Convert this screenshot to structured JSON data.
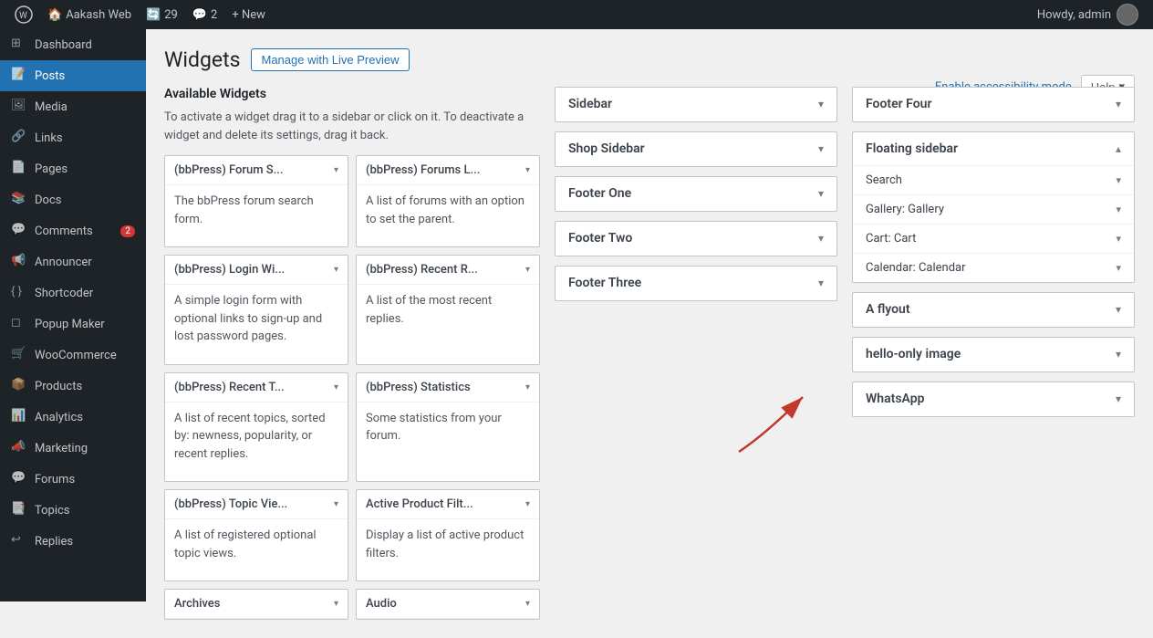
{
  "adminbar": {
    "wp_logo": "⊞",
    "site_name": "Aakash Web",
    "updates_count": "29",
    "comments_count": "2",
    "new_label": "+ New",
    "howdy": "Howdy, admin"
  },
  "sidebar": {
    "items": [
      {
        "id": "dashboard",
        "label": "Dashboard",
        "icon": "⊞"
      },
      {
        "id": "posts",
        "label": "Posts",
        "icon": "📝",
        "active": true
      },
      {
        "id": "media",
        "label": "Media",
        "icon": "🖼"
      },
      {
        "id": "links",
        "label": "Links",
        "icon": "🔗"
      },
      {
        "id": "pages",
        "label": "Pages",
        "icon": "📄"
      },
      {
        "id": "docs",
        "label": "Docs",
        "icon": "📚"
      },
      {
        "id": "comments",
        "label": "Comments",
        "icon": "💬",
        "badge": "2"
      },
      {
        "id": "announcer",
        "label": "Announcer",
        "icon": "📢"
      },
      {
        "id": "shortcoder",
        "label": "Shortcoder",
        "icon": "{ }"
      },
      {
        "id": "popup-maker",
        "label": "Popup Maker",
        "icon": "◻"
      },
      {
        "id": "woocommerce",
        "label": "WooCommerce",
        "icon": "🛒"
      },
      {
        "id": "products",
        "label": "Products",
        "icon": "📦"
      },
      {
        "id": "analytics",
        "label": "Analytics",
        "icon": "📊"
      },
      {
        "id": "marketing",
        "label": "Marketing",
        "icon": "📣"
      },
      {
        "id": "forums",
        "label": "Forums",
        "icon": "💬"
      },
      {
        "id": "topics",
        "label": "Topics",
        "icon": "📑"
      },
      {
        "id": "replies",
        "label": "Replies",
        "icon": "↩"
      }
    ]
  },
  "page": {
    "title": "Widgets",
    "live_preview_btn": "Manage with Live Preview",
    "accessibility_link": "Enable accessibility mode",
    "help_btn": "Help"
  },
  "available_widgets": {
    "heading": "Available Widgets",
    "description_part1": "To activate a widget drag it to a sidebar or click on it. To deactivate a widget and delete its settings, drag it back.",
    "widgets": [
      {
        "id": "w1",
        "title": "(bbPress) Forum S...",
        "desc": "The bbPress forum search form."
      },
      {
        "id": "w2",
        "title": "(bbPress) Forums L...",
        "desc": "A list of forums with an option to set the parent."
      },
      {
        "id": "w3",
        "title": "(bbPress) Login Wi...",
        "desc": "A simple login form with optional links to sign-up and lost password pages."
      },
      {
        "id": "w4",
        "title": "(bbPress) Recent R...",
        "desc": "A list of the most recent replies."
      },
      {
        "id": "w5",
        "title": "(bbPress) Recent T...",
        "desc": "A list of recent topics, sorted by: newness, popularity, or recent replies."
      },
      {
        "id": "w6",
        "title": "(bbPress) Statistics",
        "desc": "Some statistics from your forum."
      },
      {
        "id": "w7",
        "title": "(bbPress) Topic Vie...",
        "desc": "A list of registered optional topic views."
      },
      {
        "id": "w8",
        "title": "Active Product Filt...",
        "desc": "Display a list of active product filters."
      },
      {
        "id": "w9",
        "title": "Archives",
        "desc": ""
      },
      {
        "id": "w10",
        "title": "Audio",
        "desc": ""
      }
    ]
  },
  "sidebar_areas_col1": [
    {
      "id": "sidebar",
      "title": "Sidebar",
      "open": false
    },
    {
      "id": "shop-sidebar",
      "title": "Shop Sidebar",
      "open": false
    },
    {
      "id": "footer-one",
      "title": "Footer One",
      "open": false
    },
    {
      "id": "footer-two",
      "title": "Footer Two",
      "open": false
    },
    {
      "id": "footer-three",
      "title": "Footer Three",
      "open": false
    }
  ],
  "sidebar_areas_col2": [
    {
      "id": "footer-four",
      "title": "Footer Four",
      "open": false
    },
    {
      "id": "floating-sidebar",
      "title": "Floating sidebar",
      "open": true,
      "sub_widgets": [
        {
          "title": "Search"
        },
        {
          "title": "Gallery: Gallery"
        },
        {
          "title": "Cart: Cart"
        },
        {
          "title": "Calendar: Calendar"
        }
      ]
    },
    {
      "id": "a-flyout",
      "title": "A flyout",
      "open": false
    },
    {
      "id": "hello-only-image",
      "title": "hello-only image",
      "open": false
    },
    {
      "id": "whatsapp",
      "title": "WhatsApp",
      "open": false
    }
  ]
}
